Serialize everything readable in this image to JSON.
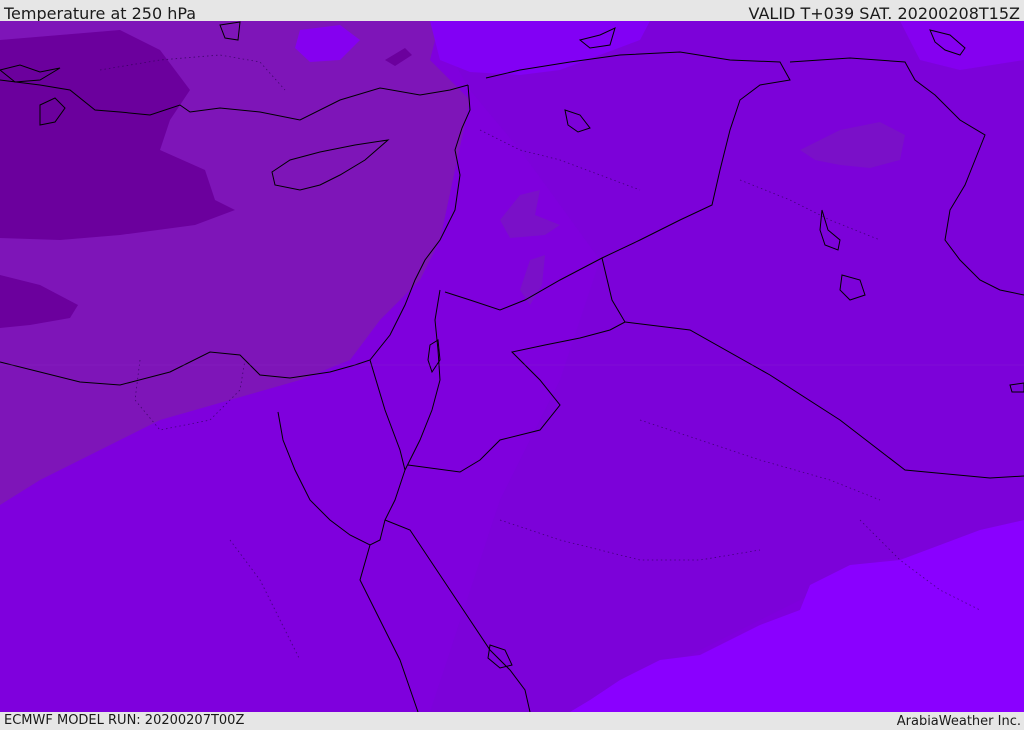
{
  "header": {
    "title": "Temperature at 250 hPa",
    "valid": "VALID T+039 SAT. 20200208T15Z"
  },
  "footer": {
    "model_run": "ECMWF MODEL RUN: 20200207T00Z",
    "credit": "ArabiaWeather Inc."
  },
  "map": {
    "colors": {
      "base": "#7f00dd",
      "warm_band": "#7800d4",
      "cold_band": "#7e15b8",
      "colder_core": "#6b009d",
      "warm_patch": "#8f00ff",
      "cold_patch": "#7a10c8",
      "coastline": "#000000"
    }
  }
}
